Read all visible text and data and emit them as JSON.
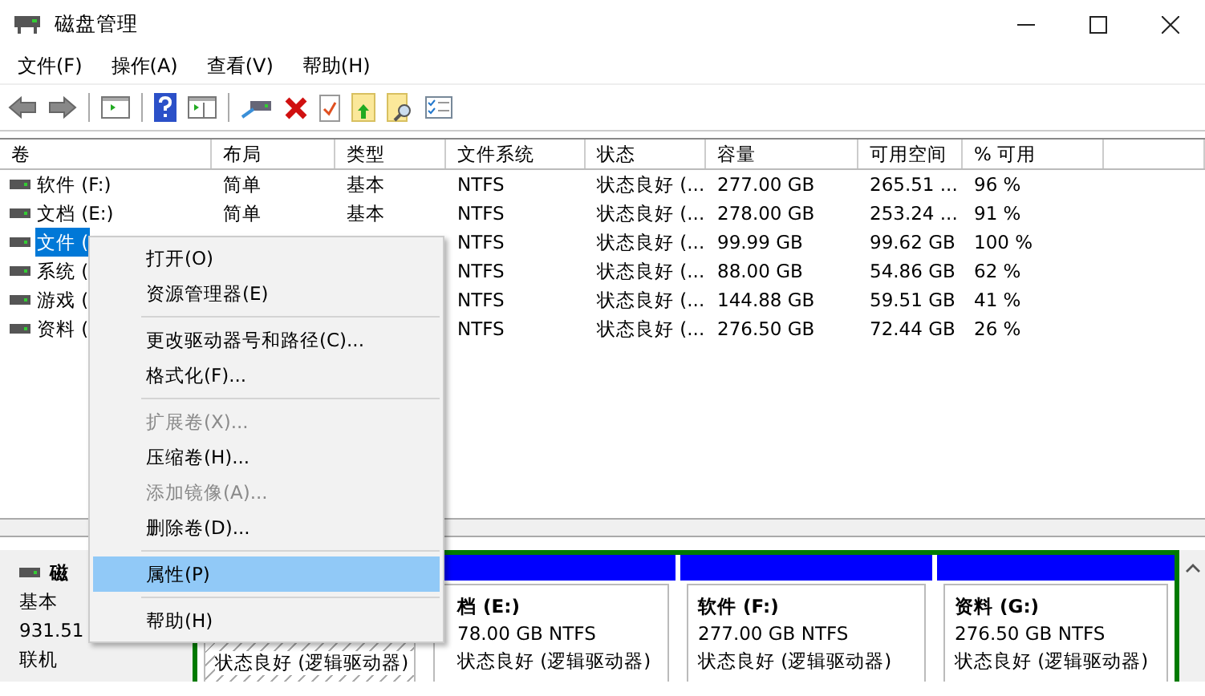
{
  "window": {
    "title": "磁盘管理"
  },
  "menu_bar": [
    "文件(F)",
    "操作(A)",
    "查看(V)",
    "帮助(H)"
  ],
  "table": {
    "columns": [
      "卷",
      "布局",
      "类型",
      "文件系统",
      "状态",
      "容量",
      "可用空间",
      "% 可用"
    ],
    "rows": [
      {
        "selected": false,
        "volume": "软件 (F:)",
        "layout": "简单",
        "type": "基本",
        "fs": "NTFS",
        "status": "状态良好 (...",
        "capacity": "277.00 GB",
        "free": "265.51 ...",
        "pct": "96 %"
      },
      {
        "selected": false,
        "volume": "文档 (E:)",
        "layout": "简单",
        "type": "基本",
        "fs": "NTFS",
        "status": "状态良好 (...",
        "capacity": "278.00 GB",
        "free": "253.24 ...",
        "pct": "91 %"
      },
      {
        "selected": true,
        "volume": "文件 (",
        "fs": "NTFS",
        "status": "状态良好 (...",
        "capacity": "99.99 GB",
        "free": "99.62 GB",
        "pct": "100 %"
      },
      {
        "selected": false,
        "volume": "系统 (",
        "fs": "NTFS",
        "status": "状态良好 (...",
        "capacity": "88.00 GB",
        "free": "54.86 GB",
        "pct": "62 %"
      },
      {
        "selected": false,
        "volume": "游戏 (",
        "fs": "NTFS",
        "status": "状态良好 (...",
        "capacity": "144.88 GB",
        "free": "59.51 GB",
        "pct": "41 %"
      },
      {
        "selected": false,
        "volume": "资料 (",
        "fs": "NTFS",
        "status": "状态良好 (...",
        "capacity": "276.50 GB",
        "free": "72.44 GB",
        "pct": "26 %"
      }
    ]
  },
  "disk": {
    "name": "磁",
    "type": "基本",
    "size": "931.51",
    "state": "联机",
    "partitions": [
      {
        "hatched": true,
        "status": "状态良好 (逻辑驱动器)"
      },
      {
        "hatched": false,
        "name": "档 (E:)",
        "size": "78.00 GB NTFS",
        "status": "状态良好 (逻辑驱动器)"
      },
      {
        "hatched": false,
        "name": "软件  (F:)",
        "size": "277.00 GB NTFS",
        "status": "状态良好 (逻辑驱动器)"
      },
      {
        "hatched": false,
        "name": "资料  (G:)",
        "size": "276.50 GB NTFS",
        "status": "状态良好 (逻辑驱动器)"
      }
    ]
  },
  "context_menu": [
    {
      "kind": "item",
      "label": "打开(O)",
      "disabled": false,
      "selected": false
    },
    {
      "kind": "item",
      "label": "资源管理器(E)",
      "disabled": false,
      "selected": false
    },
    {
      "kind": "separator"
    },
    {
      "kind": "item",
      "label": "更改驱动器号和路径(C)...",
      "disabled": false,
      "selected": false
    },
    {
      "kind": "item",
      "label": "格式化(F)...",
      "disabled": false,
      "selected": false
    },
    {
      "kind": "separator"
    },
    {
      "kind": "item",
      "label": "扩展卷(X)...",
      "disabled": true,
      "selected": false
    },
    {
      "kind": "item",
      "label": "压缩卷(H)...",
      "disabled": false,
      "selected": false
    },
    {
      "kind": "item",
      "label": "添加镜像(A)...",
      "disabled": true,
      "selected": false
    },
    {
      "kind": "item",
      "label": "删除卷(D)...",
      "disabled": false,
      "selected": false
    },
    {
      "kind": "separator"
    },
    {
      "kind": "item",
      "label": "属性(P)",
      "disabled": false,
      "selected": true
    },
    {
      "kind": "separator"
    },
    {
      "kind": "item",
      "label": "帮助(H)",
      "disabled": false,
      "selected": false
    }
  ]
}
